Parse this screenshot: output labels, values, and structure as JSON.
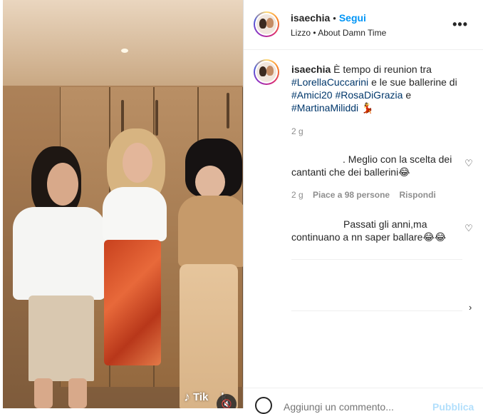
{
  "post": {
    "username": "isaechia",
    "separator": "•",
    "follow_label": "Segui",
    "audio_label": "Lizzo • About Damn Time",
    "more_icon": "more-horizontal-icon"
  },
  "caption": {
    "username": "isaechia",
    "text_1": "È tempo di reunion tra",
    "tag_1": "#LorellaCuccarini",
    "text_2": "e le sue ballerine di",
    "tag_2": "#Amici20",
    "tag_3": "#RosaDiGrazia",
    "text_3": "e",
    "tag_4": "#MartinaMiliddi",
    "emoji": "💃",
    "time": "2 g"
  },
  "comments": [
    {
      "text_line1": ". Meglio con la scelta dei",
      "text_line2": "cantanti che dei ballerini😂",
      "time": "2 g",
      "likes": "Piace a 98 persone",
      "reply": "Rispondi"
    },
    {
      "text_line1": "Passati gli anni,ma",
      "text_line2": "continuano a nn saper ballare😂😂"
    }
  ],
  "more_replies_icon": "chevron-right-icon",
  "video": {
    "watermark": "Tik",
    "watermark_suffix": "k",
    "mute_icon": "muted-speaker-icon"
  },
  "composer": {
    "placeholder": "Aggiungi un commento...",
    "publish_label": "Pubblica"
  },
  "colors": {
    "accent_blue": "#0095f6",
    "hashtag": "#00376b",
    "muted_text": "#8e8e8e",
    "publish_disabled": "#b2dffc"
  }
}
